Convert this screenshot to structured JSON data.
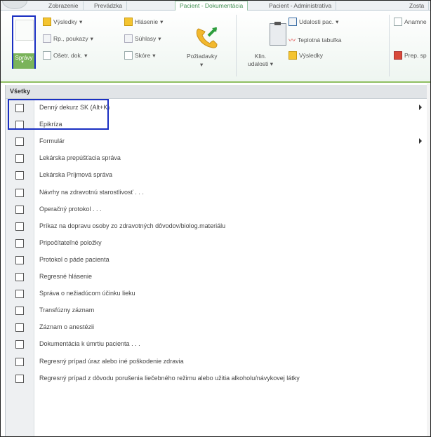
{
  "tabs": [
    {
      "label": "Zobrazenie"
    },
    {
      "label": "Prevádzka"
    },
    {
      "label": "Pacient - Dokumentácia"
    },
    {
      "label": "Pacient - Administratíva"
    },
    {
      "label": "Zosta"
    }
  ],
  "ribbon": {
    "spravy": {
      "label": "Správy"
    },
    "vysledky1": "Výsledky",
    "rp_poukazy": "Rp., poukazy",
    "obetr_dok": "Ošetr. dok.",
    "hlasenie": "Hlásenie",
    "suhlasy": "Súhlasy",
    "skore": "Skóre",
    "poziadavky": "Požiadavky",
    "klin_udalosti_1": "Klin.",
    "klin_udalosti_2": "udalosti",
    "udalosti_pac": "Udalosti pac.",
    "teplotna_tabulka": "Teplotná tabuľka",
    "vysledky2": "Výsledky",
    "anamnez": "Anamne",
    "prep_sp": "Prep. sp"
  },
  "dropdown": {
    "header": "Všetky",
    "items": [
      {
        "label": "Denný dekurz SK  (Alt+K)",
        "submenu": true
      },
      {
        "label": "Epikríza",
        "submenu": false
      },
      {
        "label": "Formulár",
        "submenu": true
      },
      {
        "label": "Lekárska prepúšťacia správa",
        "submenu": false
      },
      {
        "label": "Lekárska Príjmová správa",
        "submenu": false
      },
      {
        "label": "Návrhy na zdravotnú starostlivosť . . .",
        "submenu": false
      },
      {
        "label": "Operačný protokol . . .",
        "submenu": false
      },
      {
        "label": "Príkaz na dopravu osoby zo zdravotných dôvodov/biolog.materiálu",
        "submenu": false
      },
      {
        "label": "Pripočítateľné položky",
        "submenu": false
      },
      {
        "label": "Protokol o páde pacienta",
        "submenu": false
      },
      {
        "label": "Regresné hlásenie",
        "submenu": false
      },
      {
        "label": "Správa o nežiadúcom účinku lieku",
        "submenu": false
      },
      {
        "label": "Transfúzny záznam",
        "submenu": false
      },
      {
        "label": "Záznam o anestézii",
        "submenu": false
      },
      {
        "label": "Dokumentácia k úmrtiu pacienta . . .",
        "submenu": false
      },
      {
        "label": "Regresný prípad úraz alebo iné poškodenie zdravia",
        "submenu": false
      },
      {
        "label": "Regresný prípad z dôvodu porušenia liečebného režimu alebo užitia alkoholu/návykovej látky",
        "submenu": false
      }
    ]
  },
  "colors": {
    "accent_green": "#3e8e4f",
    "highlight_blue": "#1a2fc2"
  }
}
